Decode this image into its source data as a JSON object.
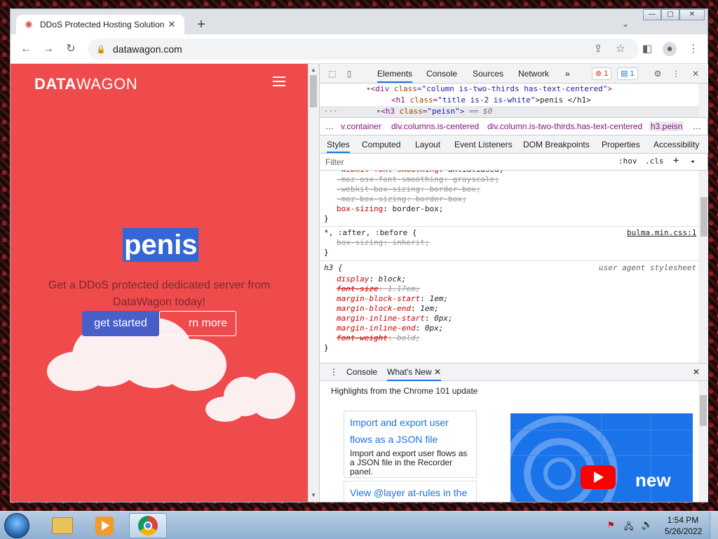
{
  "colors": {
    "page_bg": "#ef4b4c",
    "primary_btn": "#485fc7",
    "selection": "#3367d6",
    "devtools_accent": "#1a73e8"
  },
  "browser": {
    "tab_title": "DDoS Protected Hosting Solution",
    "tab_close": "✕",
    "new_tab": "+",
    "url": "datawagon.com",
    "window_buttons": [
      "—",
      "▢",
      "✕"
    ]
  },
  "page": {
    "brand_bold": "DATA",
    "brand_light": "WAGON",
    "hero_title": "penis",
    "hero_subtitle": "Get a DDoS protected dedicated server from DataWagon today!",
    "btn_primary": "get started",
    "btn_outline": "rn more"
  },
  "devtools": {
    "tabs": [
      "Elements",
      "Console",
      "Sources",
      "Network"
    ],
    "more_tabs": "»",
    "error_count": "1",
    "message_count": "1",
    "dom": {
      "line1_tag_open": "<div ",
      "line1_attr": "class",
      "line1_val": "\"column is-two-thirds has-text-centered\"",
      "line1_close": ">",
      "line2_open": "<h1 ",
      "line2_attr": "class",
      "line2_val": "\"title is-2 is-white\"",
      "line2_text": ">penis </h1>",
      "line3_open": "<h3 ",
      "line3_attr": "class",
      "line3_val": "\"peisn\"",
      "line3_close": ">",
      "line3_eq": " == $0"
    },
    "breadcrumbs": [
      "…",
      "v.container",
      "div.columns.is-centered",
      "div.column.is-two-thirds.has-text-centered",
      "h3.peisn",
      "…"
    ],
    "subtabs": [
      "Styles",
      "Computed",
      "Layout",
      "Event Listeners",
      "DOM Breakpoints",
      "Properties",
      "Accessibility"
    ],
    "filter_placeholder": "Filter",
    "filter_hov": ":hov",
    "filter_cls": ".cls",
    "filter_plus": "+",
    "styles": {
      "rule1": [
        {
          "prop": "-webkit-font-smoothing",
          "val": "antialiased;",
          "struck": false
        },
        {
          "prop": "-moz-osx-font-smoothing",
          "val": "grayscale;",
          "struck": true
        },
        {
          "prop": "-webkit-box-sizing",
          "val": "border-box;",
          "struck": true
        },
        {
          "prop": "-moz-box-sizing",
          "val": "border-box;",
          "struck": true
        },
        {
          "prop": "box-sizing",
          "val": "border-box;",
          "struck": false
        }
      ],
      "rule1_close": "}",
      "rule2_selector": "*, :after, :before {",
      "rule2_source": "bulma.min.css:1",
      "rule2_prop": "box-sizing",
      "rule2_val": "inherit;",
      "rule2_close": "}",
      "rule3_selector": "h3 {",
      "rule3_source": "user agent stylesheet",
      "rule3": [
        {
          "prop": "display",
          "val": "block;",
          "struck": false
        },
        {
          "prop": "font-size",
          "val": "1.17em;",
          "struck": true
        },
        {
          "prop": "margin-block-start",
          "val": "1em;",
          "struck": false
        },
        {
          "prop": "margin-block-end",
          "val": "1em;",
          "struck": false
        },
        {
          "prop": "margin-inline-start",
          "val": "0px;",
          "struck": false
        },
        {
          "prop": "margin-inline-end",
          "val": "0px;",
          "struck": false
        },
        {
          "prop": "font-weight",
          "val": "bold;",
          "struck": true
        }
      ],
      "rule3_close": "}"
    },
    "drawer": {
      "tabs": [
        "Console",
        "What's New"
      ],
      "close_tab": "✕",
      "headline": "Highlights from the Chrome 101 update",
      "card1_link": "Import and export user flows as a JSON file",
      "card1_desc": "Import and export user flows as a JSON file in the Recorder panel.",
      "card2_link": "View @layer at-rules in the",
      "video_word": "new"
    }
  },
  "taskbar": {
    "time": "1:54 PM",
    "date": "5/26/2022"
  }
}
